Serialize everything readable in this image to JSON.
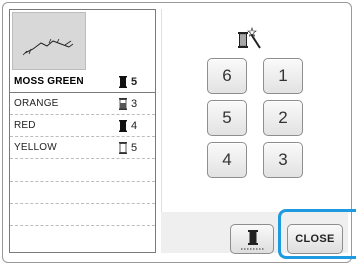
{
  "colors": [
    {
      "name": "MOSS GREEN",
      "count": "5",
      "spool": "filled"
    },
    {
      "name": "ORANGE",
      "count": "3",
      "spool": "half"
    },
    {
      "name": "RED",
      "count": "4",
      "spool": "filled"
    },
    {
      "name": "YELLOW",
      "count": "5",
      "spool": "empty"
    }
  ],
  "sequence_buttons": [
    "6",
    "1",
    "5",
    "2",
    "4",
    "3"
  ],
  "footer": {
    "close_label": "CLOSE"
  },
  "accent_color": "#1e9be0"
}
